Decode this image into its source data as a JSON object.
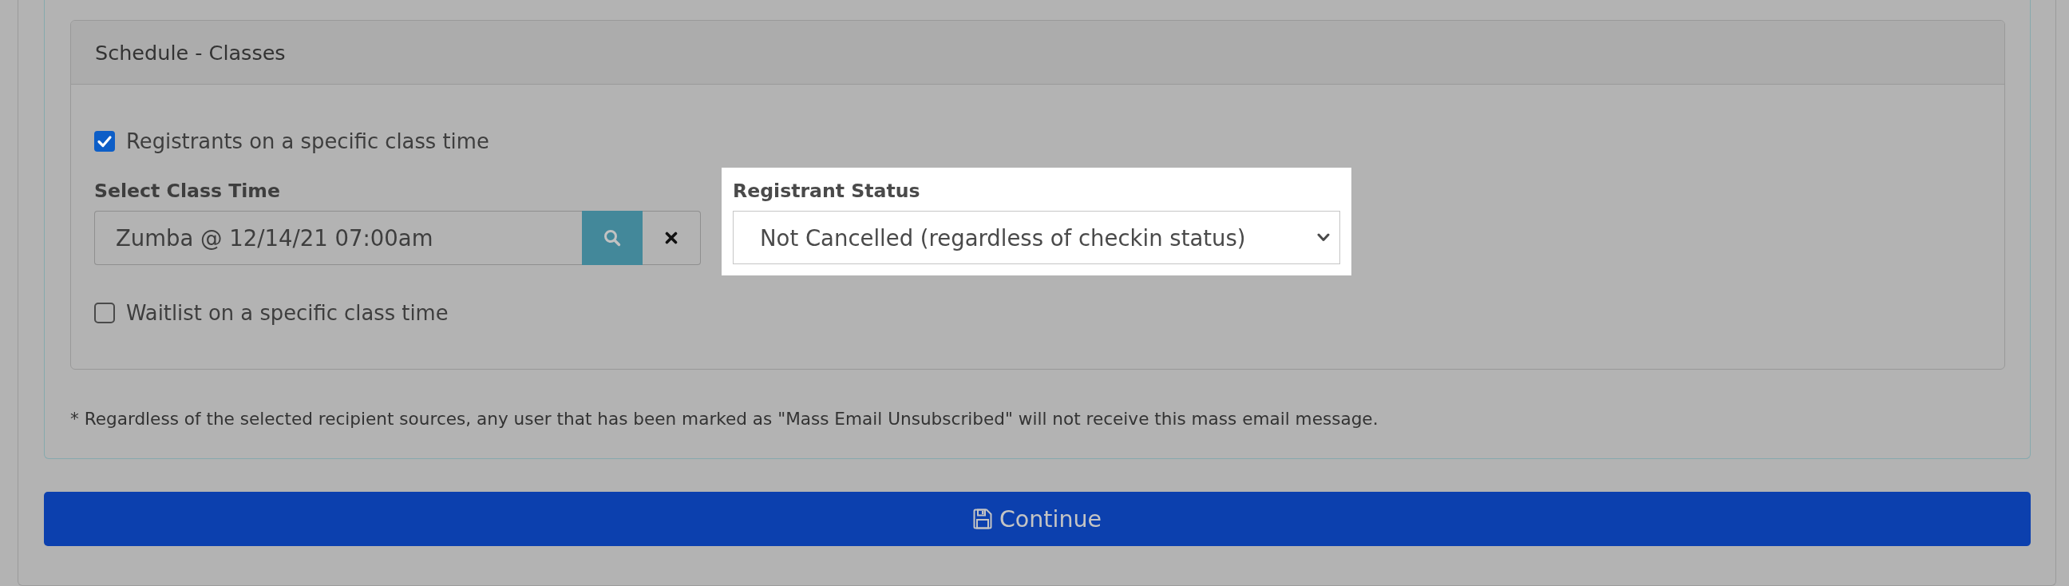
{
  "panel": {
    "title": "Schedule - Classes",
    "registrants_option": {
      "label": "Registrants on a specific class time",
      "checked": true
    },
    "class_time": {
      "label": "Select Class Time",
      "value": "Zumba @ 12/14/21 07:00am"
    },
    "registrant_status": {
      "label": "Registrant Status",
      "value": "Not Cancelled (regardless of checkin status)",
      "highlighted": true
    },
    "waitlist_option": {
      "label": "Waitlist on a specific class time",
      "checked": false
    }
  },
  "footnote": "* Regardless of the selected recipient sources, any user that has been marked as \"Mass Email Unsubscribed\" will not receive this mass email message.",
  "continue_button": {
    "label": "Continue"
  }
}
